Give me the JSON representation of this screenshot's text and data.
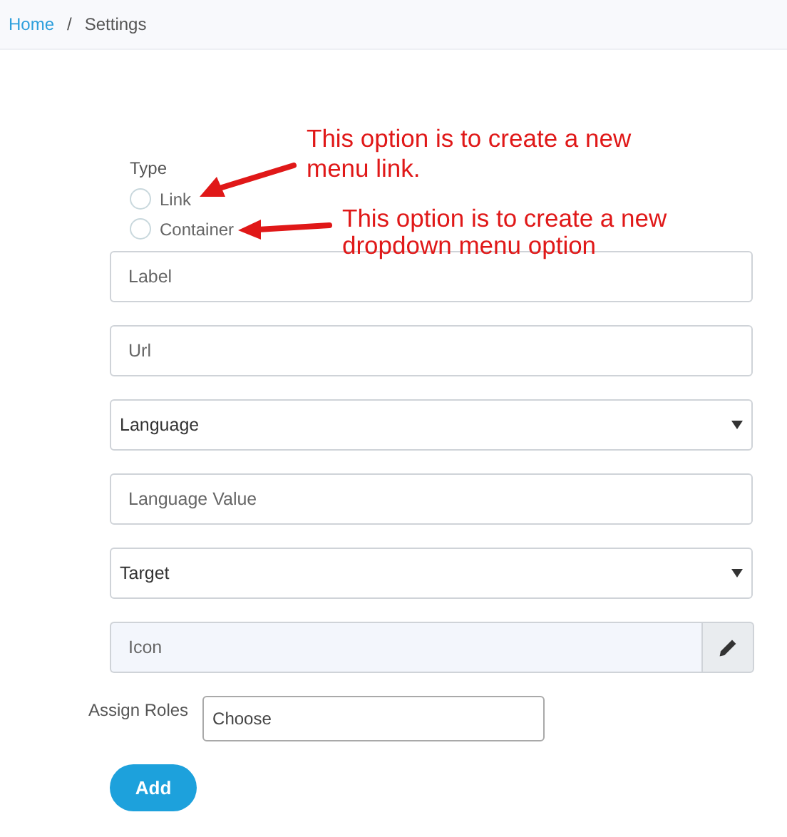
{
  "breadcrumb": [
    {
      "label": "Home",
      "kind": "link"
    },
    {
      "label": "/",
      "kind": "separator"
    },
    {
      "label": "Settings",
      "kind": "current"
    }
  ],
  "type_group": {
    "label": "Type",
    "options": [
      {
        "label": "Link",
        "selected": false
      },
      {
        "label": "Container",
        "selected": false
      }
    ]
  },
  "annotations": [
    {
      "text": "This option is to create a new menu link."
    },
    {
      "text": "This option is to create a new dropdown menu option"
    }
  ],
  "fields": [
    {
      "kind": "text",
      "placeholder": "Label"
    },
    {
      "kind": "text",
      "placeholder": "Url"
    },
    {
      "kind": "select",
      "value": "Language"
    },
    {
      "kind": "text",
      "placeholder": "Language Value"
    },
    {
      "kind": "select",
      "value": "Target"
    },
    {
      "kind": "icon",
      "placeholder": "Icon"
    }
  ],
  "assign_roles": {
    "label": "Assign Roles",
    "placeholder": "Choose"
  },
  "submit": {
    "label": "Add"
  }
}
